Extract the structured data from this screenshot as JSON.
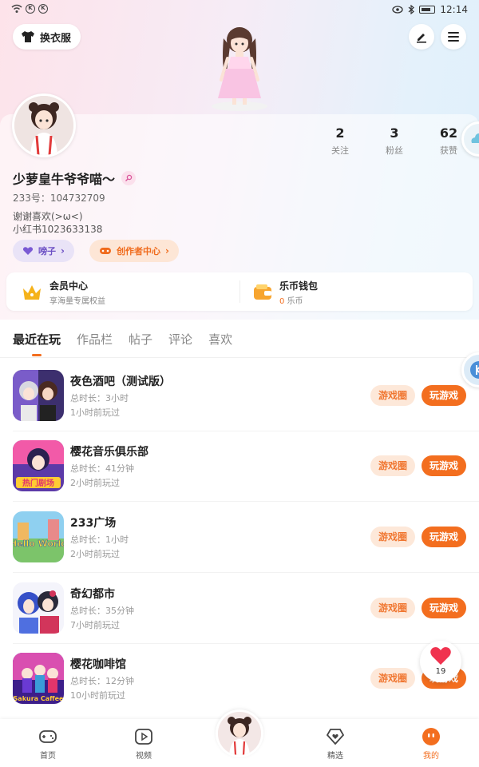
{
  "status_bar": {
    "time": "12:14"
  },
  "header": {
    "dress_button": "换衣服"
  },
  "profile": {
    "stats": [
      {
        "num": "2",
        "label": "关注"
      },
      {
        "num": "3",
        "label": "粉丝"
      },
      {
        "num": "62",
        "label": "获赞"
      }
    ],
    "username": "少萝皇牛爷爷喵～",
    "uid": "233号：104732709",
    "bio_line1": "谢谢喜欢(>ω<)",
    "bio_line2": "小红书1023633138",
    "badge_label": "嗙子",
    "creator_label": "创作者中心"
  },
  "perks": {
    "member": {
      "title": "会员中心",
      "subtitle": "享海量专属权益"
    },
    "wallet": {
      "title": "乐币钱包",
      "amount": "0",
      "unit": "乐币"
    }
  },
  "tabs": [
    "最近在玩",
    "作品栏",
    "帖子",
    "评论",
    "喜欢"
  ],
  "games": [
    {
      "name": "夜色酒吧（测试版）",
      "duration": "总时长：3小时",
      "last": "1小时前玩过",
      "btn_circle": "游戏圈",
      "btn_play": "玩游戏",
      "icon_colors": [
        "#7a5cc9",
        "#3c2f6e"
      ]
    },
    {
      "name": "樱花音乐俱乐部",
      "duration": "总时长：41分钟",
      "last": "2小时前玩过",
      "btn_circle": "游戏圈",
      "btn_play": "玩游戏",
      "icon_colors": [
        "#f25aa8",
        "#5c3aa8"
      ],
      "icon_text": "热门剧场"
    },
    {
      "name": "233广场",
      "duration": "总时长：1小时",
      "last": "2小时前玩过",
      "btn_circle": "游戏圈",
      "btn_play": "玩游戏",
      "icon_colors": [
        "#7cc46a",
        "#3d8ac9"
      ],
      "icon_text": "Hello World"
    },
    {
      "name": "奇幻都市",
      "duration": "总时长：35分钟",
      "last": "7小时前玩过",
      "btn_circle": "游戏圈",
      "btn_play": "玩游戏",
      "icon_colors": [
        "#4f6fe0",
        "#d2355b"
      ]
    },
    {
      "name": "樱花咖啡馆",
      "duration": "总时长：12分钟",
      "last": "10小时前玩过",
      "btn_circle": "游戏圈",
      "btn_play": "玩游戏",
      "icon_colors": [
        "#d94fb0",
        "#3d1e8a"
      ],
      "icon_text": "Sakura Caffee"
    }
  ],
  "like_float": {
    "count": "19"
  },
  "bottom_nav": [
    {
      "label": "首页",
      "icon": "gamepad-icon"
    },
    {
      "label": "视频",
      "icon": "video-icon"
    },
    {
      "label": "精选",
      "icon": "heart-diamond-icon"
    },
    {
      "label": "我的",
      "icon": "profile-face-icon",
      "active": true
    }
  ],
  "colors": {
    "accent": "#f36e1f",
    "purple": "#6b4fc4"
  }
}
